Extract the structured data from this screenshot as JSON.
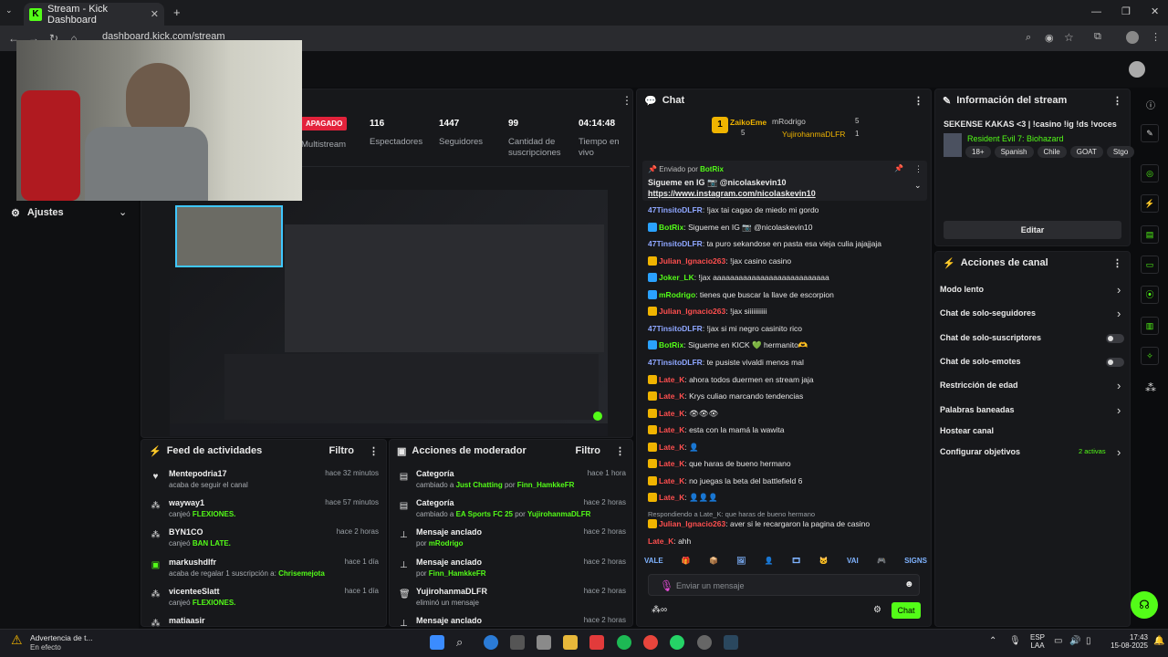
{
  "browser": {
    "tab_title": "Stream - Kick Dashboard",
    "url": "dashboard.kick.com/stream"
  },
  "stats": {
    "status": "APAGADO",
    "status_label": "Multistream",
    "viewers": "116",
    "viewers_label": "Espectadores",
    "followers": "1447",
    "followers_label": "Seguidores",
    "subs": "99",
    "subs_label": "Cantidad de suscripciones",
    "time": "04:14:48",
    "time_label": "Tiempo en vivo"
  },
  "sidebar": {
    "settings": "Ajustes"
  },
  "chat": {
    "title": "Chat",
    "top1": "ZaikoEme",
    "top1_n": "5",
    "top2": "mRodrigo",
    "top2_n": "5",
    "top3": "YujirohanmaDLFR",
    "top3_n": "1",
    "pinned_by": "Enviado por",
    "pinned_user": "BotRix",
    "pinned_text": "Sigueme en IG 📷 @nicolaskevin10",
    "pinned_link": "https://www.instagram.com/nicolaskevin10",
    "messages": [
      {
        "u": "47TinsitoDLFR",
        "c": "#8ea6ff",
        "m": "!jax tai cagao de miedo mi gordo"
      },
      {
        "u": "BotRix",
        "c": "#53fc18",
        "m": "Sigueme en IG 📷 @nicolaskevin10"
      },
      {
        "u": "47TinsitoDLFR",
        "c": "#8ea6ff",
        "m": "ta puro sekandose en pasta esa vieja culia jajajjaja"
      },
      {
        "u": "Julian_Ignacio263",
        "c": "#ff4f4f",
        "m": "!jax casino casino"
      },
      {
        "u": "Joker_LK",
        "c": "#53fc18",
        "m": "!jax aaaaaaaaaaaaaaaaaaaaaaaaaaa"
      },
      {
        "u": "mRodrigo",
        "c": "#53fc18",
        "m": "tienes que buscar la llave de escorpion"
      },
      {
        "u": "Julian_Ignacio263",
        "c": "#ff4f4f",
        "m": "!jax siiiiiiiiiii"
      },
      {
        "u": "47TinsitoDLFR",
        "c": "#8ea6ff",
        "m": "!jax si mi negro casinito rico"
      },
      {
        "u": "BotRix",
        "c": "#53fc18",
        "m": "Sigueme en KICK 💚 hermanito🫶"
      },
      {
        "u": "47TinsitoDLFR",
        "c": "#8ea6ff",
        "m": "te pusiste vivaldi menos mal"
      },
      {
        "u": "Late_K",
        "c": "#ff4f4f",
        "m": "ahora todos duermen en stream jaja"
      },
      {
        "u": "Late_K",
        "c": "#ff4f4f",
        "m": "Krys culiao marcando tendencias"
      },
      {
        "u": "Late_K",
        "c": "#ff4f4f",
        "m": "👁👁👁"
      },
      {
        "u": "Late_K",
        "c": "#ff4f4f",
        "m": "esta con la mamá la wawita"
      },
      {
        "u": "Late_K",
        "c": "#ff4f4f",
        "m": "👤"
      },
      {
        "u": "Late_K",
        "c": "#ff4f4f",
        "m": "que haras de bueno hermano"
      },
      {
        "u": "Late_K",
        "c": "#ff4f4f",
        "m": "no juegas la beta del battlefield 6"
      },
      {
        "u": "Late_K",
        "c": "#ff4f4f",
        "m": "👤👤👤"
      }
    ],
    "reply_note": "Respondiendo a Late_K: que haras de bueno hermano",
    "reply_user": "Julian_Ignacio263",
    "reply_msg": "aver si le recargaron la pagina de casino",
    "last_user": "Late_K",
    "last_msg": "ahh",
    "placeholder": "Enviar un mensaje",
    "send": "Chat",
    "emotes": [
      "VALE",
      "🎁",
      "📦",
      "🖼",
      "👤",
      "🎞",
      "🐱",
      "VAI",
      "🎮",
      "SIGNS"
    ]
  },
  "stream_info": {
    "title": "Información del stream",
    "name": "SEKENSE KAKAS <3 | !casino !ig !ds !voces",
    "game": "Resident Evil 7: Biohazard",
    "tags": [
      "18+",
      "Spanish",
      "Chile",
      "GOAT",
      "Stgo"
    ],
    "edit": "Editar"
  },
  "channel_actions": {
    "title": "Acciones de canal",
    "items": [
      "Modo lento",
      "Chat de solo-seguidores",
      "Chat de solo-suscriptores",
      "Chat de solo-emotes",
      "Restricción de edad",
      "Palabras baneadas",
      "Hostear canal",
      "Configurar objetivos"
    ],
    "active": "2 activas"
  },
  "feed": {
    "title": "Feed de actividades",
    "filter": "Filtro",
    "items": [
      {
        "t": "Mentepodria17",
        "s": "acaba de seguir el canal",
        "tm": "hace 32 minutos"
      },
      {
        "t": "wayway1",
        "s": "canjeó",
        "g": "FLEXIONES.",
        "tm": "hace 57 minutos"
      },
      {
        "t": "BYN1CO",
        "s": "canjeó",
        "g": "BAN LATE.",
        "tm": "hace 2 horas"
      },
      {
        "t": "markushdlfr",
        "s": "acaba de regalar 1 suscripción a:",
        "g": "Chrisemejota",
        "tm": "hace 1 día"
      },
      {
        "t": "vicenteeSlatt",
        "s": "canjeó",
        "g": "FLEXIONES.",
        "tm": "hace 1 día"
      },
      {
        "t": "matiaasir",
        "s": "",
        "tm": ""
      }
    ]
  },
  "mod": {
    "title": "Acciones de moderador",
    "filter": "Filtro",
    "items": [
      {
        "t": "Categoría",
        "s": "cambiado a",
        "g": "Just Chatting",
        "p": "por",
        "u": "Finn_HamkkeFR",
        "tm": "hace 1 hora"
      },
      {
        "t": "Categoría",
        "s": "cambiado a",
        "g": "EA Sports FC 25",
        "p": "por",
        "u": "YujirohanmaDLFR",
        "tm": "hace 2 horas"
      },
      {
        "t": "Mensaje anclado",
        "s": "por",
        "g": "mRodrigo",
        "tm": "hace 2 horas"
      },
      {
        "t": "Mensaje anclado",
        "s": "por",
        "g": "Finn_HamkkeFR",
        "tm": "hace 2 horas"
      },
      {
        "t": "YujirohanmaDLFR",
        "s": "eliminó un mensaje",
        "tm": "hace 2 horas"
      },
      {
        "t": "Mensaje anclado",
        "s": "",
        "tm": "hace 2 horas"
      }
    ]
  },
  "taskbar": {
    "weather_title": "Advertencia de t...",
    "weather_sub": "En efecto",
    "lang": "ESP",
    "lang2": "LAA",
    "time": "17:43",
    "date": "15-08-2025"
  }
}
